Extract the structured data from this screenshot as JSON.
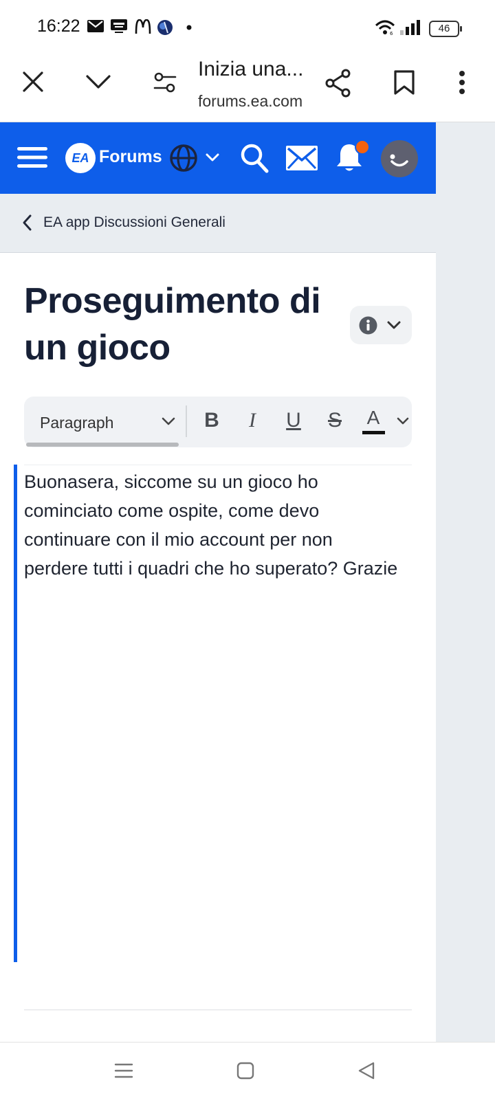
{
  "status_bar": {
    "time": "16:22",
    "notification_icons": [
      "mail-icon",
      "roma-today-icon",
      "mcdonalds-icon",
      "app-badge-icon",
      "dot-icon"
    ],
    "battery": "46",
    "signal_icons": [
      "wifi-icon",
      "cell-signal-icon"
    ]
  },
  "browser": {
    "title": "Inizia una...",
    "domain": "forums.ea.com",
    "icons": [
      "close-icon",
      "chevron-down-icon",
      "site-settings-icon",
      "share-icon",
      "bookmark-icon",
      "more-vert-icon"
    ]
  },
  "forum_header": {
    "logo_text": "EA",
    "brand": "Forums",
    "accent_color": "#0e5eea",
    "notification_dot_color": "#f5620f"
  },
  "breadcrumb": {
    "label": "EA app Discussioni Generali"
  },
  "topic": {
    "title": "Proseguimento di un gioco"
  },
  "editor": {
    "block_format": "Paragraph",
    "buttons": [
      "B",
      "I",
      "U",
      "S",
      "A"
    ],
    "body": "Buonasera, siccome su un gioco ho cominciato come ospite, come devo continuare con il mio account per non perdere tutti i quadri che ho superato? Grazie"
  }
}
